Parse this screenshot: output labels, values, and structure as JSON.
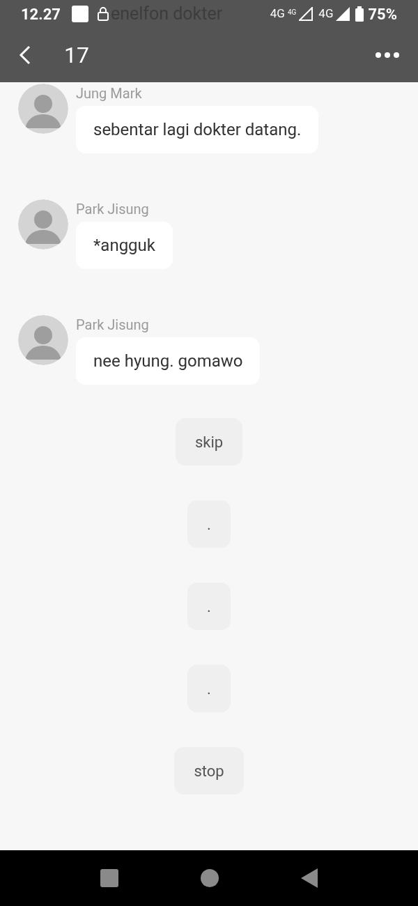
{
  "status_bar": {
    "time": "12.27",
    "faded_message": "enelfon dokter",
    "network_1": "4G",
    "network_1_small": "4G",
    "network_2": "4G",
    "battery": "75%"
  },
  "header": {
    "title": "17"
  },
  "messages": [
    {
      "sender": "Jung Mark",
      "text": "sebentar lagi dokter datang."
    },
    {
      "sender": "Park Jisung",
      "text": "*angguk"
    },
    {
      "sender": "Park Jisung",
      "text": "nee hyung. gomawo"
    }
  ],
  "choices": [
    {
      "label": "skip"
    },
    {
      "label": "."
    },
    {
      "label": "."
    },
    {
      "label": "."
    },
    {
      "label": "stop"
    }
  ]
}
